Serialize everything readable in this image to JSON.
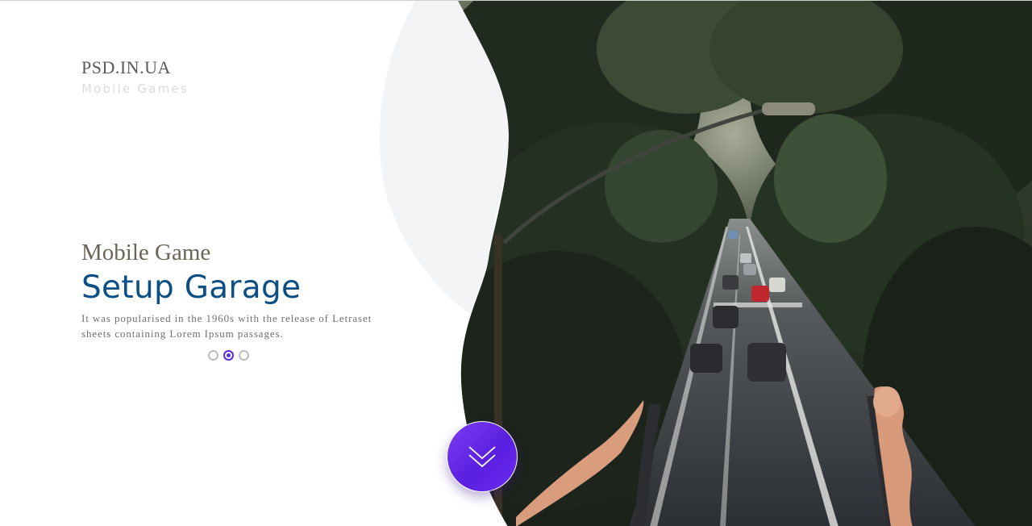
{
  "brand": {
    "title": "PSD.IN.UA",
    "subtitle": "Mobile Games"
  },
  "hero": {
    "kicker": "Mobile Game",
    "title": "Setup Garage",
    "description_line1": "It was popularised in the 1960s with the release of Letraset",
    "description_line2": "sheets containing Lorem Ipsum passages."
  },
  "slider": {
    "count": 3,
    "active_index": 1
  },
  "scroll_button": {
    "icon": "double-chevron-down-icon"
  },
  "colors": {
    "accent": "#5a2ed6",
    "title_blue": "#0c4f84",
    "blob_gray": "#f3f4f6"
  }
}
